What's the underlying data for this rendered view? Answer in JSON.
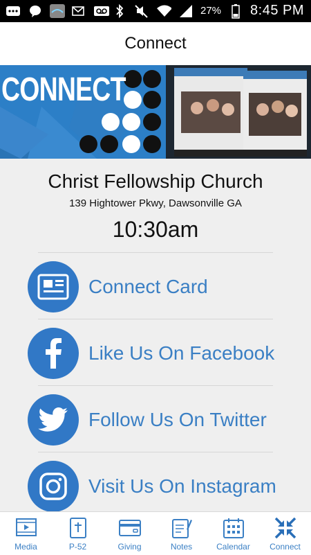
{
  "status_bar": {
    "battery": "27%",
    "time": "8:45 PM"
  },
  "header": {
    "title": "Connect"
  },
  "hero": {
    "word": "CONNECT"
  },
  "church": {
    "name": "Christ Fellowship Church",
    "address": "139 Hightower Pkwy, Dawsonville GA",
    "time": "10:30am"
  },
  "links": [
    {
      "label": "Connect Card",
      "icon": "card-icon"
    },
    {
      "label": "Like Us On Facebook",
      "icon": "facebook-icon"
    },
    {
      "label": "Follow Us On Twitter",
      "icon": "twitter-icon"
    },
    {
      "label": "Visit Us On Instagram",
      "icon": "instagram-icon"
    }
  ],
  "tabs": [
    {
      "label": "Media",
      "icon": "media-icon"
    },
    {
      "label": "P-52",
      "icon": "bible-icon"
    },
    {
      "label": "Giving",
      "icon": "card-payment-icon"
    },
    {
      "label": "Notes",
      "icon": "notes-icon"
    },
    {
      "label": "Calendar",
      "icon": "calendar-icon"
    },
    {
      "label": "Connect",
      "icon": "connect-icon"
    }
  ],
  "colors": {
    "accent": "#3178c6",
    "label": "#3a7fc4",
    "hero_blue": "#2c7fc7"
  }
}
